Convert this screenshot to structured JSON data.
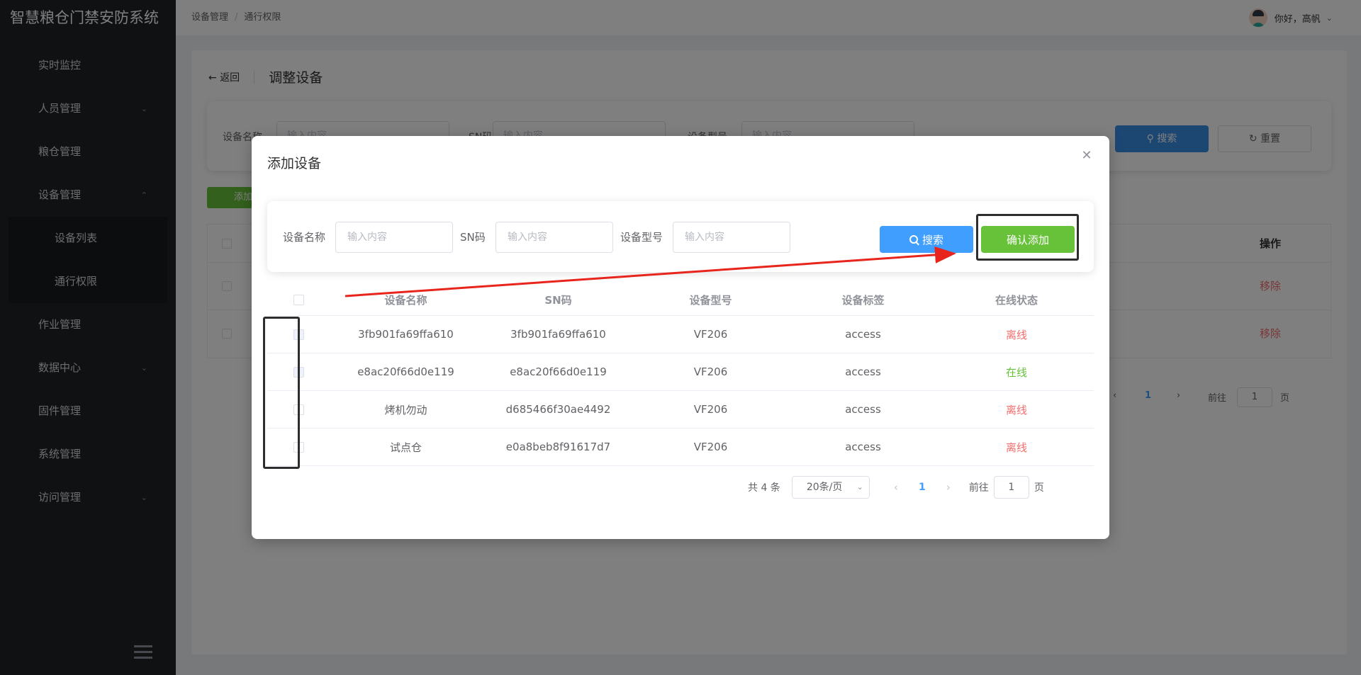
{
  "app": {
    "title": "智慧粮仓门禁安防系统"
  },
  "sidebar": {
    "items": [
      {
        "label": "实时监控"
      },
      {
        "label": "人员管理"
      },
      {
        "label": "粮仓管理"
      },
      {
        "label": "设备管理"
      }
    ],
    "sub_items": [
      {
        "label": "设备列表"
      },
      {
        "label": "通行权限"
      }
    ],
    "items_after": [
      {
        "label": "作业管理"
      },
      {
        "label": "数据中心"
      },
      {
        "label": "固件管理"
      },
      {
        "label": "系统管理"
      },
      {
        "label": "访问管理"
      }
    ]
  },
  "header": {
    "breadcrumb": [
      "设备管理",
      "通行权限"
    ],
    "greeting": "你好，高帆"
  },
  "page": {
    "back_label": "返回",
    "title": "调整设备",
    "filters": {
      "name_label": "设备名称",
      "sn_label": "SN码",
      "model_label": "设备型号",
      "placeholder": "输入内容"
    },
    "search_label": "搜索",
    "reset_label": "重置",
    "add_label": "添加",
    "table_op_header": "操作",
    "remove_label": "移除",
    "pager": {
      "current": "1",
      "goto_prefix": "前往",
      "goto_value": "1",
      "goto_suffix": "页"
    }
  },
  "dialog": {
    "title": "添加设备",
    "filters": {
      "name_label": "设备名称",
      "name_placeholder": "输入内容",
      "sn_label": "SN码",
      "sn_placeholder": "输入内容",
      "model_label": "设备型号",
      "model_placeholder": "输入内容"
    },
    "search_label": "搜索",
    "confirm_label": "确认添加",
    "table": {
      "headers": {
        "name": "设备名称",
        "sn": "SN码",
        "model": "设备型号",
        "tag": "设备标签",
        "status": "在线状态"
      },
      "rows": [
        {
          "name": "3fb901fa69ffa610",
          "sn": "3fb901fa69ffa610",
          "model": "VF206",
          "tag": "access",
          "status": "离线",
          "disabled": true
        },
        {
          "name": "e8ac20f66d0e119",
          "sn": "e8ac20f66d0e119",
          "model": "VF206",
          "tag": "access",
          "status": "在线",
          "disabled": true
        },
        {
          "name": "烤机勿动",
          "sn": "d685466f30ae4492",
          "model": "VF206",
          "tag": "access",
          "status": "离线",
          "disabled": false
        },
        {
          "name": "试点仓",
          "sn": "e0a8beb8f91617d7",
          "model": "VF206",
          "tag": "access",
          "status": "离线",
          "disabled": false
        }
      ]
    },
    "pager": {
      "total": "共 4 条",
      "page_size": "20条/页",
      "current": "1",
      "goto_prefix": "前往",
      "goto_value": "1",
      "goto_suffix": "页"
    }
  },
  "colors": {
    "primary": "#409eff",
    "success": "#67c23a",
    "danger": "#f56c6c",
    "sidebar_bg": "#1f2326",
    "annotation_arrow": "#e8251c"
  }
}
